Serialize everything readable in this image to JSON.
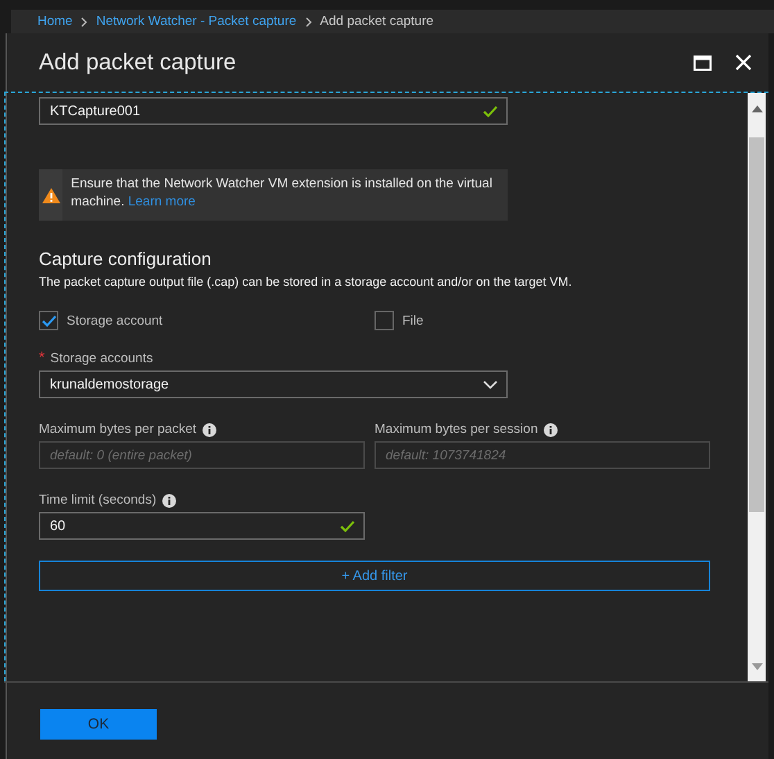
{
  "breadcrumb": [
    {
      "label": "Home",
      "current": false
    },
    {
      "label": "Network Watcher - Packet capture",
      "current": false
    },
    {
      "label": "Add packet capture",
      "current": true
    }
  ],
  "panel": {
    "title": "Add packet capture"
  },
  "name_field": {
    "value": "KTCapture001",
    "valid": true
  },
  "notice": {
    "text": "Ensure that the Network Watcher VM extension is installed on the virtual machine.",
    "link": "Learn more"
  },
  "section": {
    "heading": "Capture configuration",
    "description": "The packet capture output file (.cap) can be stored in a storage account and/or on the target VM."
  },
  "destinations": [
    {
      "label": "Storage account",
      "checked": true
    },
    {
      "label": "File",
      "checked": false
    }
  ],
  "storage_accounts": {
    "required_mark": "*",
    "label": "Storage accounts",
    "value": "krunaldemostorage"
  },
  "limits": [
    {
      "label": "Maximum bytes per packet",
      "placeholder": "default: 0 (entire packet)"
    },
    {
      "label": "Maximum bytes per session",
      "placeholder": "default: 1073741824"
    }
  ],
  "time_limit": {
    "label": "Time limit (seconds)",
    "value": "60",
    "valid": true
  },
  "add_filter": "+ Add filter",
  "ok_button": "OK"
}
